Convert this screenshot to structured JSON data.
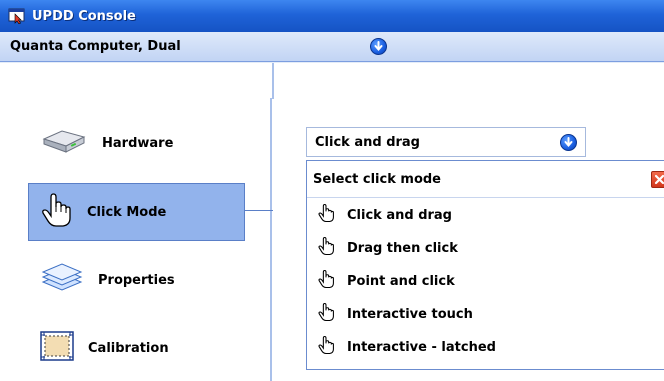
{
  "window": {
    "title": "UPDD Console"
  },
  "device_bar": {
    "name": "Quanta Computer, Dual"
  },
  "sidebar": {
    "items": [
      {
        "label": "Hardware",
        "icon": "hardware-drive-icon"
      },
      {
        "label": "Click Mode",
        "icon": "hand-pointer-icon",
        "selected": true
      },
      {
        "label": "Properties",
        "icon": "layers-icon"
      },
      {
        "label": "Calibration",
        "icon": "calibration-target-icon"
      }
    ]
  },
  "click_mode": {
    "current_value": "Click and drag",
    "dropdown": {
      "header": "Select click mode",
      "options": [
        "Click and drag",
        "Drag then click",
        "Point and click",
        "Interactive touch",
        "Interactive - latched"
      ]
    }
  },
  "colors": {
    "titlebar": "#1f63d8",
    "selected_nav": "#92b3ec",
    "close_button": "#d2361b"
  }
}
